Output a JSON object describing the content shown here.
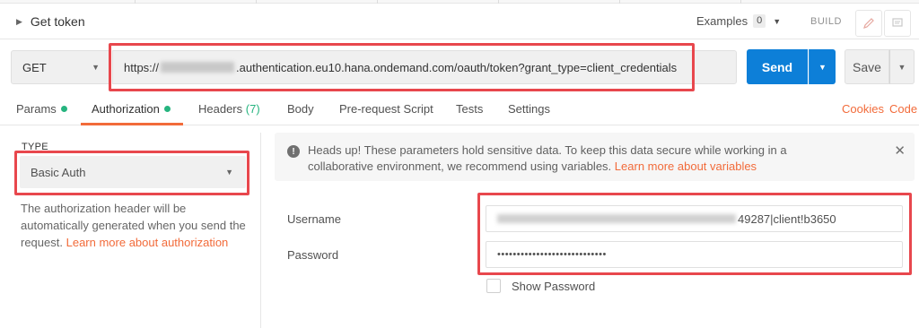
{
  "header": {
    "request_name": "Get token",
    "examples_label": "Examples",
    "examples_count": "0",
    "build_label": "BUILD"
  },
  "request": {
    "method": "GET",
    "url_prefix": "https://",
    "url_suffix": ".authentication.eu10.hana.ondemand.com/oauth/token?grant_type=client_credentials",
    "send_label": "Send",
    "save_label": "Save"
  },
  "tabs": {
    "params": "Params",
    "authorization": "Authorization",
    "headers": "Headers",
    "headers_count": "(7)",
    "body": "Body",
    "prerequest": "Pre-request Script",
    "tests": "Tests",
    "settings": "Settings",
    "cookies": "Cookies",
    "code": "Code"
  },
  "auth": {
    "type_label": "TYPE",
    "type_value": "Basic Auth",
    "description": "The authorization header will be automatically generated when you send the request.",
    "learn_more": "Learn more about authorization"
  },
  "banner": {
    "message": "Heads up! These parameters hold sensitive data. To keep this data secure while working in a collaborative environment, we recommend using variables.",
    "link": "Learn more about variables"
  },
  "fields": {
    "username_label": "Username",
    "username_visible": "49287|client!b3650",
    "password_label": "Password",
    "password_value": "••••••••••••••••••••••••••••",
    "show_password_label": "Show Password"
  },
  "colors": {
    "accent": "#f26b3a",
    "send_blue": "#0d7fd8",
    "status_green": "#26b47f",
    "highlight_red": "#e8474d"
  },
  "icons": {
    "expand": "caret-right-icon",
    "dropdown": "chevron-down-icon",
    "edit": "pencil-icon",
    "comments": "comment-icon",
    "info": "info-icon",
    "close": "close-icon"
  }
}
